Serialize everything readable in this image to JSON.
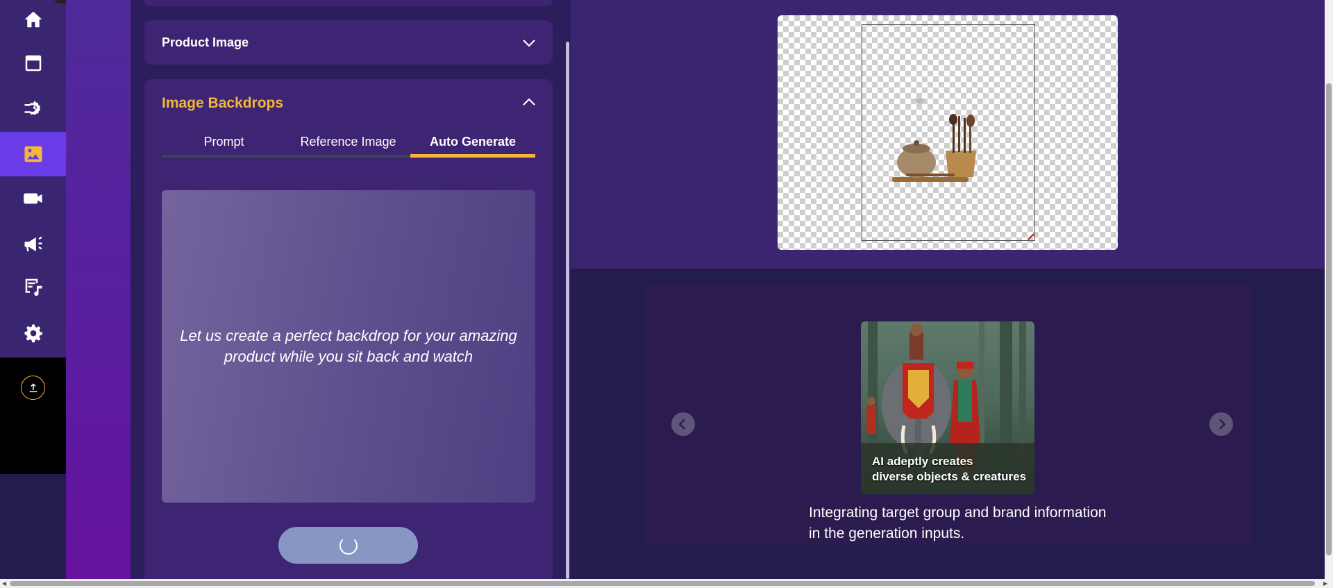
{
  "sidebar": {
    "items": [
      {
        "icon": "home-icon",
        "active": false
      },
      {
        "icon": "calendar-icon",
        "active": false
      },
      {
        "icon": "process-gear-icon",
        "active": false
      },
      {
        "icon": "image-icon",
        "active": true
      },
      {
        "icon": "video-camera-icon",
        "active": false
      },
      {
        "icon": "megaphone-icon",
        "active": false
      },
      {
        "icon": "script-music-icon",
        "active": false
      },
      {
        "icon": "settings-gear-icon",
        "active": false
      }
    ],
    "upload_icon": "upload-icon"
  },
  "panel": {
    "product_image": {
      "title": "Product Image",
      "expanded": false
    },
    "image_backdrops": {
      "title": "Image Backdrops",
      "expanded": true,
      "tabs": [
        "Prompt",
        "Reference Image",
        "Auto Generate"
      ],
      "active_tab": "Auto Generate",
      "auto_generate_text": "Let us create a perfect backdrop for your amazing product while you sit back and watch",
      "generate_button_state": "loading"
    }
  },
  "carousel": {
    "slide_caption_line1": "AI adeptly creates",
    "slide_caption_line2": "diverse objects & creatures",
    "description_line1": "Integrating target group and brand information",
    "description_line2": "in the generation inputs."
  },
  "colors": {
    "accent": "#f4b73a",
    "active_nav": "#6a3ce8",
    "panel_bg": "#2c1e5c",
    "accordion_bg": "#3e2573"
  }
}
